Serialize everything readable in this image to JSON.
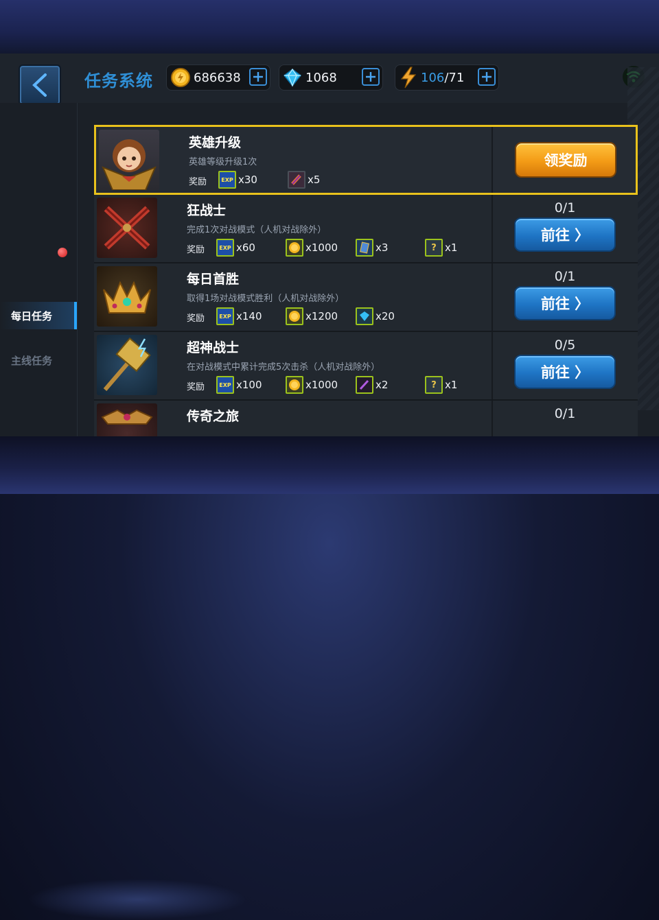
{
  "header": {
    "title": "任务系统",
    "gold": "686638",
    "diamonds": "1068",
    "energy_current": "106",
    "energy_max": "/71"
  },
  "sidebar": {
    "tabs": [
      {
        "label": "每日任务",
        "active": true
      },
      {
        "label": "主线任务",
        "active": false
      }
    ]
  },
  "reward_label": "奖励",
  "tasks": [
    {
      "name": "英雄升级",
      "desc": "英雄等级升级1次",
      "status": "claimable",
      "button": "领奖励",
      "rewards": [
        {
          "icon": "exp-icon",
          "qty": "x30"
        },
        {
          "icon": "scroll-item-icon",
          "qty": "x5"
        }
      ]
    },
    {
      "name": "狂战士",
      "desc": "完成1次对战模式（人机对战除外）",
      "progress": "0/1",
      "button": "前往 〉",
      "rewards": [
        {
          "icon": "exp-icon",
          "qty": "x60"
        },
        {
          "icon": "gold-coin-icon",
          "qty": "x1000"
        },
        {
          "icon": "card-icon",
          "qty": "x3"
        },
        {
          "icon": "mystery-box-icon",
          "qty": "x1"
        }
      ]
    },
    {
      "name": "每日首胜",
      "desc": "取得1场对战模式胜利（人机对战除外）",
      "progress": "0/1",
      "button": "前往 〉",
      "rewards": [
        {
          "icon": "exp-icon",
          "qty": "x140"
        },
        {
          "icon": "gold-coin-icon",
          "qty": "x1200"
        },
        {
          "icon": "diamond-icon",
          "qty": "x20"
        }
      ]
    },
    {
      "name": "超神战士",
      "desc": "在对战模式中累计完成5次击杀（人机对战除外）",
      "progress": "0/5",
      "button": "前往 〉",
      "rewards": [
        {
          "icon": "exp-icon",
          "qty": "x100"
        },
        {
          "icon": "gold-coin-icon",
          "qty": "x1000"
        },
        {
          "icon": "potion-icon",
          "qty": "x2"
        },
        {
          "icon": "mystery-box-icon",
          "qty": "x1"
        }
      ]
    },
    {
      "name": "传奇之旅",
      "progress": "0/1"
    }
  ],
  "colors": {
    "accent_blue": "#2f8fd6",
    "highlight_gold": "#e9c21c",
    "claim_orange": "#f39b16",
    "go_blue": "#1e74c4",
    "notification_red": "#d11b1b",
    "wifi_green": "#2fd14a"
  }
}
